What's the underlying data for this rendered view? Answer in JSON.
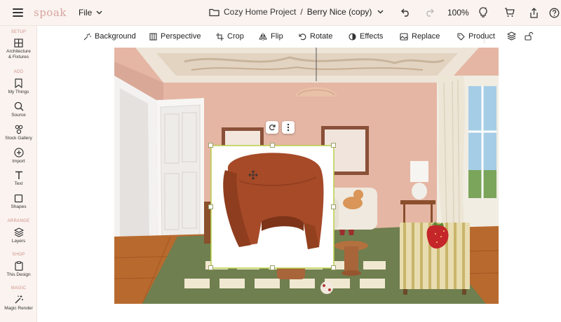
{
  "app": {
    "logo": "spoak"
  },
  "topbar": {
    "file_label": "File",
    "project_name": "Cozy Home Project",
    "separator": "/",
    "design_name": "Berry Nice (copy)",
    "zoom": "100%"
  },
  "sidebar": {
    "sections": {
      "setup": "SETUP",
      "add": "ADD",
      "arrange": "ARRANGE",
      "shop": "SHOP",
      "magic": "MAGIC"
    },
    "items": [
      {
        "label_1": "Architecture",
        "label_2": "& Fixtures",
        "icon": "grid-icon"
      },
      {
        "label_1": "My Things",
        "icon": "bookmark-icon"
      },
      {
        "label_1": "Source",
        "icon": "search-icon"
      },
      {
        "label_1": "Stock Gallery",
        "icon": "gallery-icon"
      },
      {
        "label_1": "Import",
        "icon": "plus-circle-icon"
      },
      {
        "label_1": "Text",
        "icon": "text-icon"
      },
      {
        "label_1": "Shapes",
        "icon": "square-icon"
      },
      {
        "label_1": "Layers",
        "icon": "layers-icon"
      },
      {
        "label_1": "This Design",
        "icon": "clipboard-icon"
      },
      {
        "label_1": "Magic Render",
        "icon": "magic-wand-icon"
      }
    ]
  },
  "toolbar": {
    "background": "Background",
    "perspective": "Perspective",
    "crop": "Crop",
    "flip": "Flip",
    "rotate": "Rotate",
    "effects": "Effects",
    "replace": "Replace",
    "product": "Product"
  },
  "colors": {
    "accent": "#d08e88",
    "selection": "#b8d14a",
    "wall": "#e8b9a8",
    "chair": "#a64a28",
    "rug": "#6f7f4f"
  }
}
